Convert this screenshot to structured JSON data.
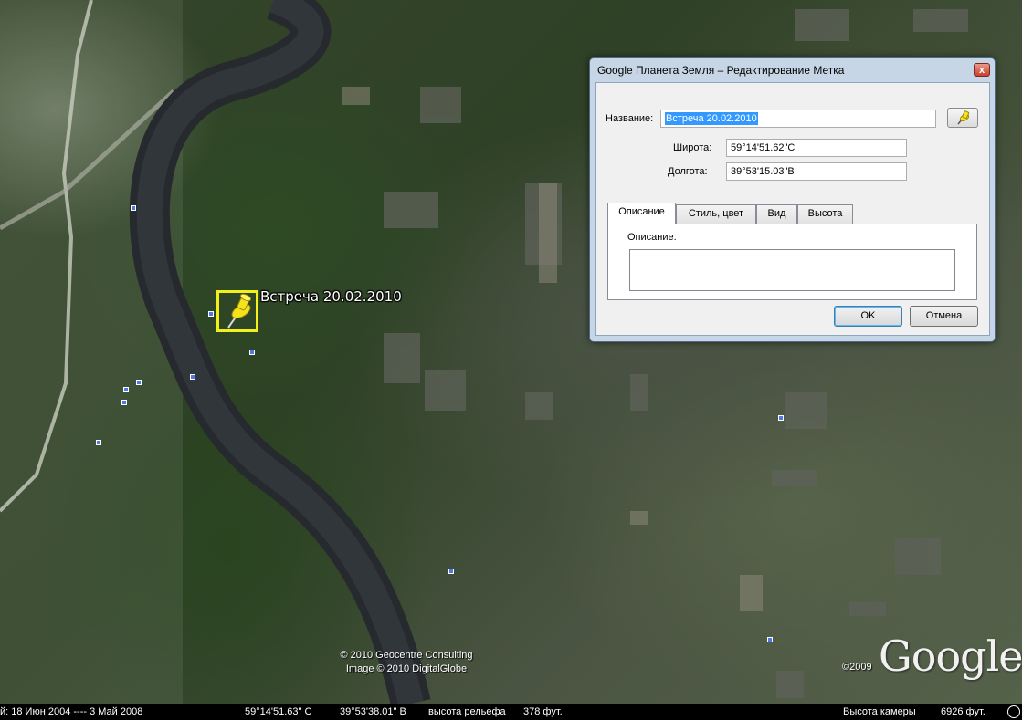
{
  "map": {
    "placemark_label": "Встреча 20.02.2010",
    "attribution": [
      "© 2010 Geocentre Consulting",
      "Image © 2010 DigitalGlobe"
    ],
    "logo_text": "Google",
    "logo_year": "©2009"
  },
  "statusbar": {
    "date_range": "й: 18 Июн 2004 ---- 3 Май 2008",
    "latitude": "59°14'51.63\" С",
    "longitude": "39°53'38.01\" В",
    "elev_label": "высота рельефа",
    "elev_value": "378 фут.",
    "eye_label": "Высота камеры",
    "eye_value": "6926 фут."
  },
  "dialog": {
    "title": "Google Планета Земля – Редактирование Метка",
    "close_label": "x",
    "name_label": "Название:",
    "name_value": "Встреча 20.02.2010",
    "lat_label": "Широта:",
    "lat_value": "59°14'51.62\"С",
    "lon_label": "Долгота:",
    "lon_value": "39°53'15.03\"В",
    "tabs": [
      {
        "label": "Описание",
        "active": true
      },
      {
        "label": "Стиль, цвет",
        "active": false
      },
      {
        "label": "Вид",
        "active": false
      },
      {
        "label": "Высота",
        "active": false
      }
    ],
    "desc_label": "Описание:",
    "desc_value": "",
    "ok_label": "OK",
    "cancel_label": "Отмена"
  },
  "icons": {
    "placemark": "yellow-pushpin-icon",
    "poi": "blue-square-marker-icon",
    "pin_button": "pushpin-icon",
    "compass": "compass-icon"
  },
  "colors": {
    "placemark_highlight": "#f2f01a",
    "selection": "#3399ff",
    "poi": "#4f78e8"
  }
}
